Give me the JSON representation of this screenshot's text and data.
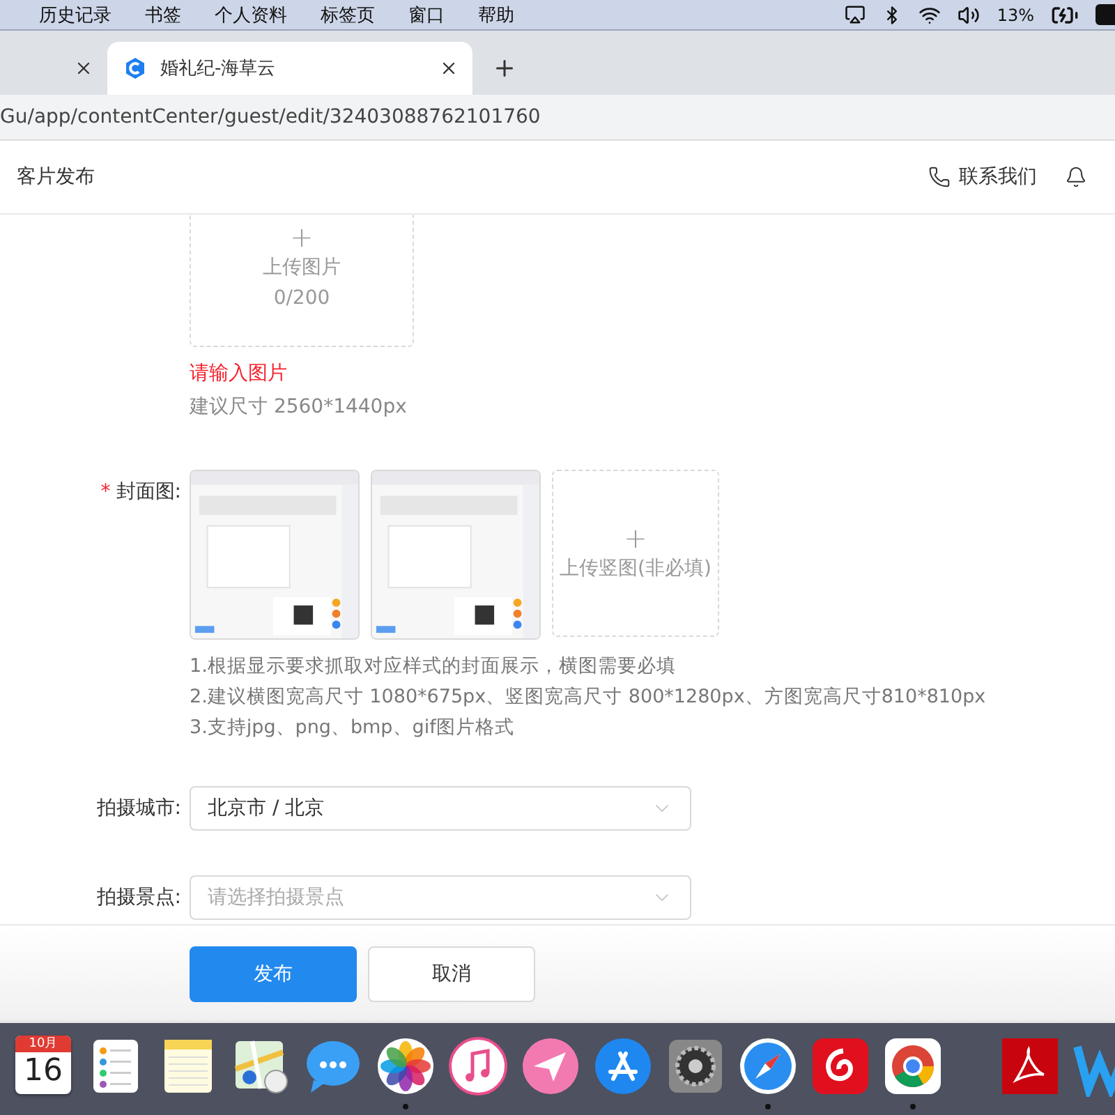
{
  "menu_bar": {
    "items": [
      "历史记录",
      "书签",
      "个人资料",
      "标签页",
      "窗口",
      "帮助"
    ],
    "battery": "13%"
  },
  "tabs": [
    {
      "selected": false
    },
    {
      "title": "婚礼纪-海草云",
      "selected": true
    }
  ],
  "address_bar": {
    "url": "Gu/app/contentCenter/guest/edit/32403088762101760"
  },
  "header": {
    "title": "客片发布",
    "contact": "联系我们"
  },
  "image_upload": {
    "plus": "+",
    "label": "上传图片",
    "count": "0/200",
    "error": "请输入图片",
    "hint": "建议尺寸 2560*1440px"
  },
  "cover": {
    "required_mark": "*",
    "label": "封面图:",
    "upload_plus": "+",
    "upload_label": "上传竖图(非必填)",
    "notes": [
      "1.根据显示要求抓取对应样式的封面展示，横图需要必填",
      "2.建议横图宽高尺寸 1080*675px、竖图宽高尺寸 800*1280px、方图宽高尺寸810*810px",
      "3.支持jpg、png、bmp、gif图片格式"
    ]
  },
  "fields": [
    {
      "kind": "select",
      "label": "拍摄城市:",
      "value": "北京市 / 北京"
    },
    {
      "kind": "select",
      "label": "拍摄景点:",
      "placeholder": "请选择拍摄景点"
    }
  ],
  "footer_buttons": [
    {
      "label": "发布",
      "kind": "primary"
    },
    {
      "label": "取消",
      "kind": "default"
    }
  ],
  "dock": [
    {
      "kind": "calendar",
      "month": "10月",
      "day": "16",
      "running": false
    },
    {
      "kind": "list",
      "running": false
    },
    {
      "kind": "notes",
      "running": false
    },
    {
      "kind": "map",
      "running": false
    },
    {
      "kind": "chat",
      "running": false
    },
    {
      "kind": "photos",
      "running": true
    },
    {
      "kind": "music",
      "running": false
    },
    {
      "kind": "plane",
      "running": false
    },
    {
      "kind": "appstore",
      "running": false
    },
    {
      "kind": "gear",
      "running": false
    },
    {
      "kind": "compass",
      "running": true
    },
    {
      "kind": "swirl",
      "running": false
    },
    {
      "kind": "chrome",
      "running": true
    },
    {
      "kind": "separator"
    },
    {
      "kind": "pdf",
      "running": false
    },
    {
      "kind": "w",
      "running": false
    }
  ]
}
